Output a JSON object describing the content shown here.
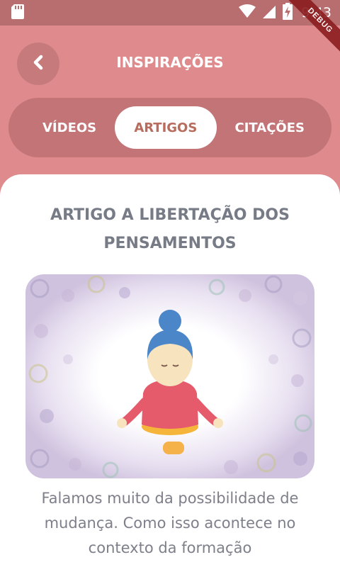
{
  "status_bar": {
    "time": "9:43",
    "debug_label": "DEBUG"
  },
  "header": {
    "title": "INSPIRAÇÕES"
  },
  "tabs": [
    {
      "label": "VÍDEOS",
      "active": false
    },
    {
      "label": "ARTIGOS",
      "active": true
    },
    {
      "label": "CITAÇÕES",
      "active": false
    }
  ],
  "article": {
    "title": "ARTIGO A LIBERTAÇÃO DOS PENSAMENTOS",
    "excerpt": "Falamos muito da possibilidade de mudança. Como isso acontece no contexto da formação"
  },
  "colors": {
    "header_bg": "#df8b8d",
    "status_bar_bg": "#b86d6f",
    "tab_bar_bg": "#c27476",
    "active_tab_text": "#b86c5d",
    "title_text": "#767b86"
  }
}
